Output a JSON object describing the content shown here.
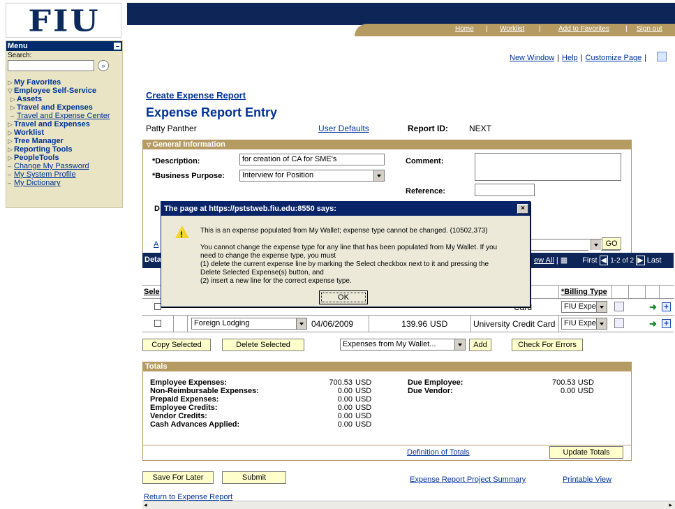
{
  "branding": {
    "logo_text": "FIU"
  },
  "menu": {
    "title": "Menu",
    "search_label": "Search:",
    "search_value": "",
    "search_go": "»",
    "items": [
      {
        "label": "My Favorites",
        "type": "folder",
        "marker": "▷"
      },
      {
        "label": "Employee Self-Service",
        "type": "folder-open",
        "marker": "▽"
      },
      {
        "label": "Assets",
        "type": "subfolder",
        "marker": "▷"
      },
      {
        "label": "Travel and Expenses",
        "type": "subfolder",
        "marker": "▷"
      },
      {
        "label": "Travel and Expense Center",
        "type": "sublink",
        "marker": "–"
      },
      {
        "label": "Travel and Expenses",
        "type": "folder",
        "marker": "▷"
      },
      {
        "label": "Worklist",
        "type": "folder",
        "marker": "▷"
      },
      {
        "label": "Tree Manager",
        "type": "folder",
        "marker": "▷"
      },
      {
        "label": "Reporting Tools",
        "type": "folder",
        "marker": "▷"
      },
      {
        "label": "PeopleTools",
        "type": "folder",
        "marker": "▷"
      },
      {
        "label": "Change My Password",
        "type": "link",
        "marker": "–"
      },
      {
        "label": "My System Profile",
        "type": "link",
        "marker": "–"
      },
      {
        "label": "My Dictionary",
        "type": "link",
        "marker": "–"
      }
    ]
  },
  "header_links": {
    "home": "Home",
    "worklist": "Worklist",
    "add_favorites": "Add to Favorites",
    "sign_out": "Sign out",
    "sep": "|"
  },
  "toolbar": {
    "new_window": "New Window",
    "help": "Help",
    "customize_page": "Customize Page",
    "sep": "|"
  },
  "page": {
    "create_title": "Create Expense Report",
    "entry_title": "Expense Report Entry",
    "user_name": "Patty Panther",
    "user_defaults": "User Defaults",
    "report_id_label": "Report ID:",
    "report_id_value": "NEXT"
  },
  "general": {
    "header": "General Information",
    "description_label": "*Description:",
    "description_value": "for creation of CA for SME's",
    "business_purpose_label": "*Business Purpose:",
    "business_purpose_value": "Interview for Position",
    "comment_label": "Comment:",
    "reference_label": "Reference:",
    "d_label": "D",
    "a_link": "A",
    "go": "GO"
  },
  "details": {
    "header": "Deta",
    "nav_view_all": "ew All",
    "nav_first": "First",
    "nav_range": "1-2 of 2",
    "nav_last": "Last",
    "col_select": "Sele",
    "col_billing_type": "*Billing Type",
    "row1": {
      "card": "Card",
      "billing": "FIU Expe"
    },
    "row2": {
      "expense_type": "Foreign Lodging",
      "date": "04/06/2009",
      "amount": "139.96",
      "currency": "USD",
      "payment": "University Credit Card",
      "billing": "FIU Expe"
    }
  },
  "actions": {
    "copy_selected": "Copy Selected",
    "delete_selected": "Delete Selected",
    "wallet_select": "Expenses from My Wallet...",
    "add": "Add",
    "check_errors": "Check For Errors"
  },
  "totals": {
    "header": "Totals",
    "rows": [
      {
        "label": "Employee Expenses:",
        "value": "700.53",
        "unit": "USD"
      },
      {
        "label": "Non-Reimbursable Expenses:",
        "value": "0.00",
        "unit": "USD"
      },
      {
        "label": "Prepaid Expenses:",
        "value": "0.00",
        "unit": "USD"
      },
      {
        "label": "Employee Credits:",
        "value": "0.00",
        "unit": "USD"
      },
      {
        "label": "Vendor Credits:",
        "value": "0.00",
        "unit": "USD"
      },
      {
        "label": "Cash Advances Applied:",
        "value": "0.00",
        "unit": "USD"
      }
    ],
    "due_employee_label": "Due Employee:",
    "due_employee_value": "700.53 USD",
    "due_vendor_label": "Due Vendor:",
    "due_vendor_value": "0.00 USD",
    "definition_link": "Definition of Totals",
    "update_button": "Update Totals"
  },
  "footer": {
    "save_later": "Save For Later",
    "submit": "Submit",
    "project_summary": "Expense Report Project Summary",
    "printable_view": "Printable View",
    "return_link": "Return to Expense Report"
  },
  "dialog": {
    "title": "The page at https://pststweb.fiu.edu:8550 says:",
    "close": "×",
    "line1": "This is an expense populated from My Wallet; expense type cannot be changed. (10502,373)",
    "line2": "You cannot change the expense type for any line that has been populated from My Wallet.  If you",
    "line3": "need to change the expense type,  you must",
    "line4": "(1) delete the current expense line by marking the Select checkbox next to it and pressing the",
    "line5": "Delete Selected Expense(s) button, and",
    "line6": "(2) insert a new line for the correct expense type.",
    "ok": "OK"
  }
}
